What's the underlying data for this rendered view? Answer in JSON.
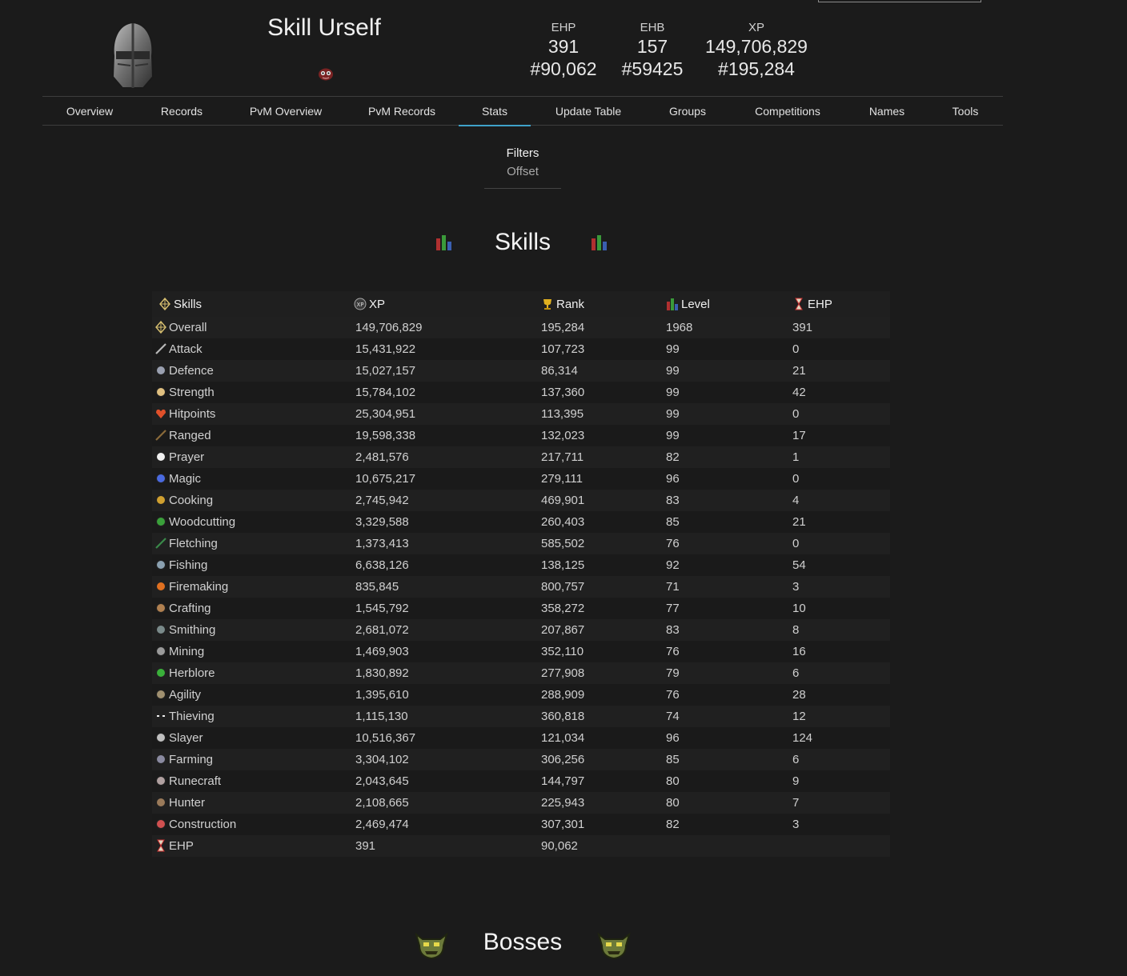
{
  "player": {
    "name": "Skill Urself"
  },
  "header_stats": [
    {
      "label": "EHP",
      "value": "391",
      "rank": "#90,062"
    },
    {
      "label": "EHB",
      "value": "157",
      "rank": "#59425"
    },
    {
      "label": "XP",
      "value": "149,706,829",
      "rank": "#195,284"
    }
  ],
  "nav": {
    "tabs": [
      {
        "label": "Overview"
      },
      {
        "label": "Records"
      },
      {
        "label": "PvM Overview"
      },
      {
        "label": "PvM Records"
      },
      {
        "label": "Stats"
      },
      {
        "label": "Update Table"
      },
      {
        "label": "Groups"
      },
      {
        "label": "Competitions"
      },
      {
        "label": "Names"
      },
      {
        "label": "Tools"
      }
    ],
    "active": "Stats"
  },
  "filters": {
    "title": "Filters",
    "offset_label": "Offset"
  },
  "skills_section": {
    "title": "Skills",
    "columns": {
      "skill": "Skills",
      "xp": "XP",
      "rank": "Rank",
      "level": "Level",
      "ehp": "EHP"
    },
    "rows": [
      {
        "skill": "Overall",
        "xp": "149,706,829",
        "rank": "195,284",
        "level": "1968",
        "ehp": "391",
        "icon": "overall-icon"
      },
      {
        "skill": "Attack",
        "xp": "15,431,922",
        "rank": "107,723",
        "level": "99",
        "ehp": "0",
        "icon": "attack-icon"
      },
      {
        "skill": "Defence",
        "xp": "15,027,157",
        "rank": "86,314",
        "level": "99",
        "ehp": "21",
        "icon": "defence-icon"
      },
      {
        "skill": "Strength",
        "xp": "15,784,102",
        "rank": "137,360",
        "level": "99",
        "ehp": "42",
        "icon": "strength-icon"
      },
      {
        "skill": "Hitpoints",
        "xp": "25,304,951",
        "rank": "113,395",
        "level": "99",
        "ehp": "0",
        "icon": "hitpoints-icon"
      },
      {
        "skill": "Ranged",
        "xp": "19,598,338",
        "rank": "132,023",
        "level": "99",
        "ehp": "17",
        "icon": "ranged-icon"
      },
      {
        "skill": "Prayer",
        "xp": "2,481,576",
        "rank": "217,711",
        "level": "82",
        "ehp": "1",
        "icon": "prayer-icon"
      },
      {
        "skill": "Magic",
        "xp": "10,675,217",
        "rank": "279,111",
        "level": "96",
        "ehp": "0",
        "icon": "magic-icon"
      },
      {
        "skill": "Cooking",
        "xp": "2,745,942",
        "rank": "469,901",
        "level": "83",
        "ehp": "4",
        "icon": "cooking-icon"
      },
      {
        "skill": "Woodcutting",
        "xp": "3,329,588",
        "rank": "260,403",
        "level": "85",
        "ehp": "21",
        "icon": "woodcutting-icon"
      },
      {
        "skill": "Fletching",
        "xp": "1,373,413",
        "rank": "585,502",
        "level": "76",
        "ehp": "0",
        "icon": "fletching-icon"
      },
      {
        "skill": "Fishing",
        "xp": "6,638,126",
        "rank": "138,125",
        "level": "92",
        "ehp": "54",
        "icon": "fishing-icon"
      },
      {
        "skill": "Firemaking",
        "xp": "835,845",
        "rank": "800,757",
        "level": "71",
        "ehp": "3",
        "icon": "firemaking-icon"
      },
      {
        "skill": "Crafting",
        "xp": "1,545,792",
        "rank": "358,272",
        "level": "77",
        "ehp": "10",
        "icon": "crafting-icon"
      },
      {
        "skill": "Smithing",
        "xp": "2,681,072",
        "rank": "207,867",
        "level": "83",
        "ehp": "8",
        "icon": "smithing-icon"
      },
      {
        "skill": "Mining",
        "xp": "1,469,903",
        "rank": "352,110",
        "level": "76",
        "ehp": "16",
        "icon": "mining-icon"
      },
      {
        "skill": "Herblore",
        "xp": "1,830,892",
        "rank": "277,908",
        "level": "79",
        "ehp": "6",
        "icon": "herblore-icon"
      },
      {
        "skill": "Agility",
        "xp": "1,395,610",
        "rank": "288,909",
        "level": "76",
        "ehp": "28",
        "icon": "agility-icon"
      },
      {
        "skill": "Thieving",
        "xp": "1,115,130",
        "rank": "360,818",
        "level": "74",
        "ehp": "12",
        "icon": "thieving-icon"
      },
      {
        "skill": "Slayer",
        "xp": "10,516,367",
        "rank": "121,034",
        "level": "96",
        "ehp": "124",
        "icon": "slayer-icon"
      },
      {
        "skill": "Farming",
        "xp": "3,304,102",
        "rank": "306,256",
        "level": "85",
        "ehp": "6",
        "icon": "farming-icon"
      },
      {
        "skill": "Runecraft",
        "xp": "2,043,645",
        "rank": "144,797",
        "level": "80",
        "ehp": "9",
        "icon": "runecraft-icon"
      },
      {
        "skill": "Hunter",
        "xp": "2,108,665",
        "rank": "225,943",
        "level": "80",
        "ehp": "7",
        "icon": "hunter-icon"
      },
      {
        "skill": "Construction",
        "xp": "2,469,474",
        "rank": "307,301",
        "level": "82",
        "ehp": "3",
        "icon": "construction-icon"
      },
      {
        "skill": "EHP",
        "xp": "391",
        "rank": "90,062",
        "level": "",
        "ehp": "",
        "icon": "hourglass-icon"
      }
    ]
  },
  "bosses_section": {
    "title": "Bosses"
  },
  "colors": {
    "background": "#1b1b1b",
    "accent": "#3fa1c9",
    "text": "#d6d6d6"
  }
}
